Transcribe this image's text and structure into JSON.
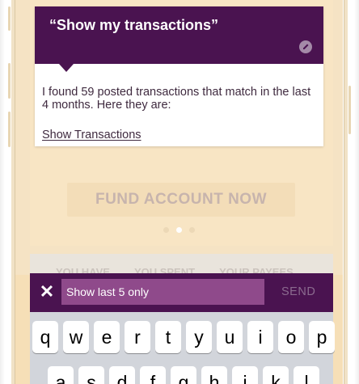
{
  "chat": {
    "query": "“Show my transactions”",
    "response": "I found 59 posted transactions that match in the last 4 months. Here they are:",
    "link_label": "Show Transactions"
  },
  "background": {
    "fund_button_label": "FUND ACCOUNT NOW",
    "tabs": [
      "YOU HAVE",
      "YOU SPENT",
      "YOUR PAYEES"
    ]
  },
  "input_bar": {
    "close_glyph": "✕",
    "input_value": "Show last 5 only",
    "send_label": "SEND"
  },
  "keyboard": {
    "row1": [
      "q",
      "w",
      "e",
      "r",
      "t",
      "y",
      "u",
      "i",
      "o",
      "p"
    ],
    "row2": [
      "a",
      "s",
      "d",
      "f",
      "g",
      "h",
      "j",
      "k",
      "l"
    ]
  },
  "colors": {
    "brand_purple": "#4a1350",
    "input_purple": "#8f4a8b",
    "background_cream": "#f6dfb7"
  }
}
